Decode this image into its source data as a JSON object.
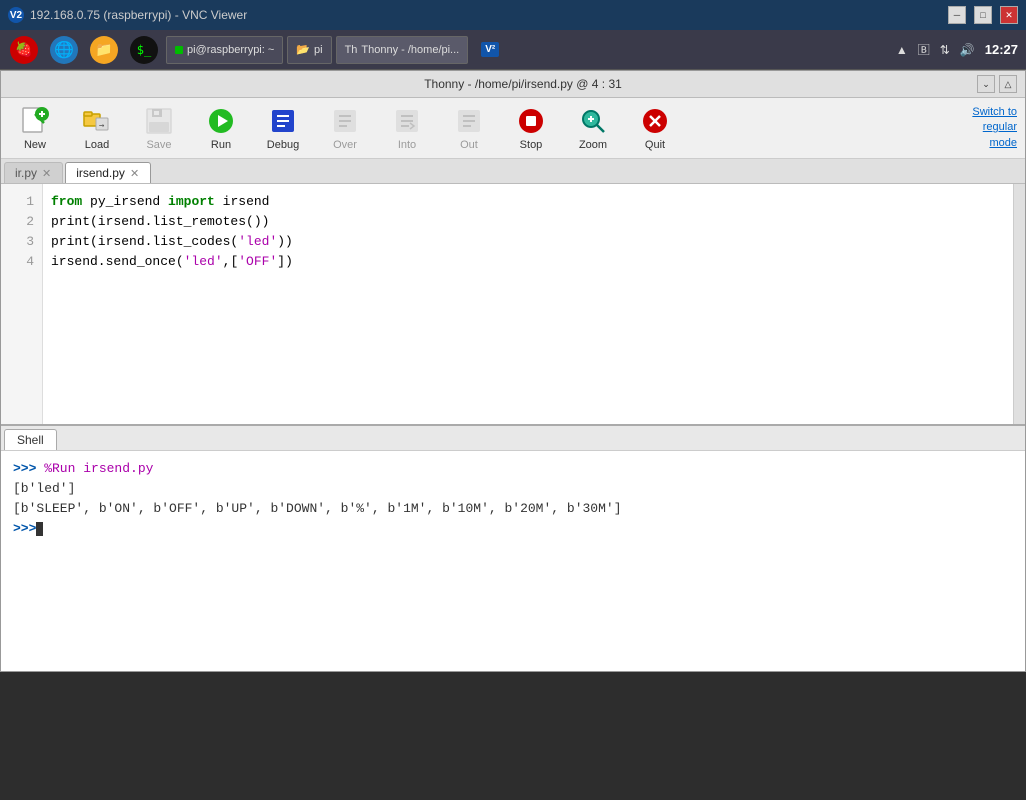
{
  "window": {
    "title": "192.168.0.75 (raspberrypi) - VNC Viewer",
    "thonny_title": "Thonny - /home/pi/irsend.py @ 4 : 31"
  },
  "taskbar": {
    "app1_label": "pi@raspberrypi: ~",
    "app2_label": "pi",
    "app3_label": "Thonny - /home/pi...",
    "clock": "12:27"
  },
  "toolbar": {
    "new_label": "New",
    "load_label": "Load",
    "save_label": "Save",
    "run_label": "Run",
    "debug_label": "Debug",
    "over_label": "Over",
    "into_label": "Into",
    "out_label": "Out",
    "stop_label": "Stop",
    "zoom_label": "Zoom",
    "quit_label": "Quit",
    "switch_text": "Switch to\nregular\nmode"
  },
  "tabs": [
    {
      "label": "ir.py",
      "closable": true,
      "active": false
    },
    {
      "label": "irsend.py",
      "closable": true,
      "active": true
    }
  ],
  "editor": {
    "lines": [
      {
        "num": 1,
        "content": [
          {
            "type": "kw",
            "text": "from"
          },
          {
            "type": "normal",
            "text": " py_irsend "
          },
          {
            "type": "kw",
            "text": "import"
          },
          {
            "type": "normal",
            "text": " irsend"
          }
        ]
      },
      {
        "num": 2,
        "content": [
          {
            "type": "normal",
            "text": "print(irsend.list_remotes())"
          }
        ]
      },
      {
        "num": 3,
        "content": [
          {
            "type": "normal",
            "text": "print(irsend.list_codes("
          },
          {
            "type": "str",
            "text": "'led'"
          },
          {
            "type": "normal",
            "text": "))"
          }
        ]
      },
      {
        "num": 4,
        "content": [
          {
            "type": "normal",
            "text": "irsend.send_once("
          },
          {
            "type": "str",
            "text": "'led'"
          },
          {
            "type": "normal",
            "text": ",["
          },
          {
            "type": "str",
            "text": "'OFF'"
          },
          {
            "type": "normal",
            "text": "])"
          }
        ]
      }
    ]
  },
  "shell": {
    "tab_label": "Shell",
    "prompt1": ">>>",
    "cmd1": " %Run irsend.py",
    "output1": "[b'led']",
    "output2": "[b'SLEEP', b'ON', b'OFF', b'UP', b'DOWN', b'%', b'1M', b'10M', b'20M', b'30M']",
    "prompt2": ">>>"
  }
}
